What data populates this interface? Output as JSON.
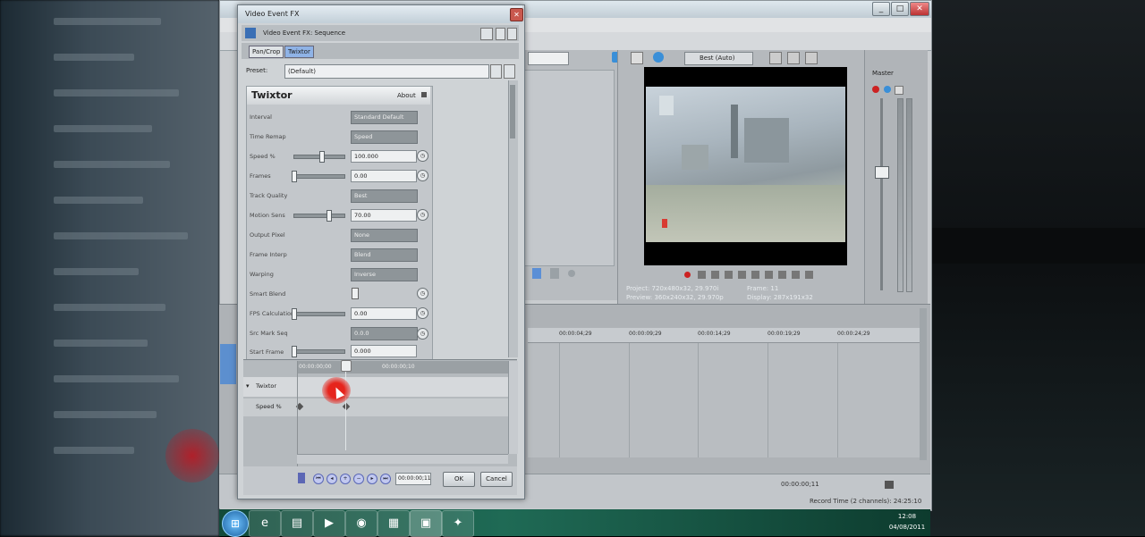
{
  "fx_dialog": {
    "title": "Video Event FX",
    "header_label": "Video Event FX: Sequence",
    "chain": {
      "item1": "Pan/Crop",
      "item2": "Twixtor"
    },
    "preset_label": "Preset:",
    "preset_value": "(Default)",
    "plugin_title": "Twixtor",
    "about_label": "About",
    "properties": [
      {
        "label": "Interval",
        "control": "Dropdown",
        "value": "Standard Default"
      },
      {
        "label": "Time Remap",
        "control": "Dropdown",
        "value": "Speed"
      },
      {
        "label": "Speed %",
        "control": "Slider",
        "value": "100.000"
      },
      {
        "label": "Frames",
        "control": "Slider",
        "value": "0.00"
      },
      {
        "label": "Track Quality",
        "control": "Dropdown",
        "value": "Best"
      },
      {
        "label": "Motion Sens",
        "control": "Slider",
        "value": "70.00"
      },
      {
        "label": "Output Pixel",
        "control": "Dropdown",
        "value": "None"
      },
      {
        "label": "Frame Interp",
        "control": "Dropdown",
        "value": "Blend"
      },
      {
        "label": "Warping",
        "control": "Dropdown",
        "value": "Inverse"
      },
      {
        "label": "Smart Blend",
        "control": "Checkbox",
        "value": ""
      },
      {
        "label": "FPS Calculation",
        "control": "Slider",
        "value": "0.00"
      },
      {
        "label": "Src Mark Seq",
        "control": "Dropdown",
        "value": "0.0.0"
      },
      {
        "label": "Start Frame",
        "control": "Slider",
        "value": "0.000"
      }
    ],
    "keyframes": {
      "ruler_labels": [
        "00:00:00;00",
        "00:00:00;10"
      ],
      "track_twixtor": "Twixtor",
      "track_speed": "Speed %",
      "time_value": "00:00:00;11"
    },
    "ok_label": "OK",
    "cancel_label": "Cancel",
    "close_glyph": "✕"
  },
  "preview": {
    "info_project": "Project: 720x480x32, 29.970i",
    "info_preview": "Preview: 360x240x32, 29.970p",
    "info_frame": "Frame: 11",
    "info_display": "Display: 287x191x32",
    "dropdown_value": "Best (Auto)"
  },
  "master_bus": {
    "label": "Master"
  },
  "timeline": {
    "ruler_labels": [
      "00:00:04;29",
      "00:00:09;29",
      "00:00:14;29",
      "00:00:19;29",
      "00:00:24;29"
    ]
  },
  "statusbar": {
    "time_left": "00:00:00;11",
    "record_time": "Record Time (2 channels): 24:25:10"
  },
  "taskbar": {
    "start_icon": "windows-orb-icon",
    "apps": [
      "ie-icon",
      "folder-icon",
      "media-player-icon",
      "chrome-icon",
      "sticky-notes-icon",
      "vegas-icon",
      "app-icon"
    ],
    "clock_time": "12:08",
    "clock_date": "04/08/2011"
  },
  "colors": {
    "cursor_highlight": "#e6241c",
    "taskbar": "#1f6a55"
  }
}
